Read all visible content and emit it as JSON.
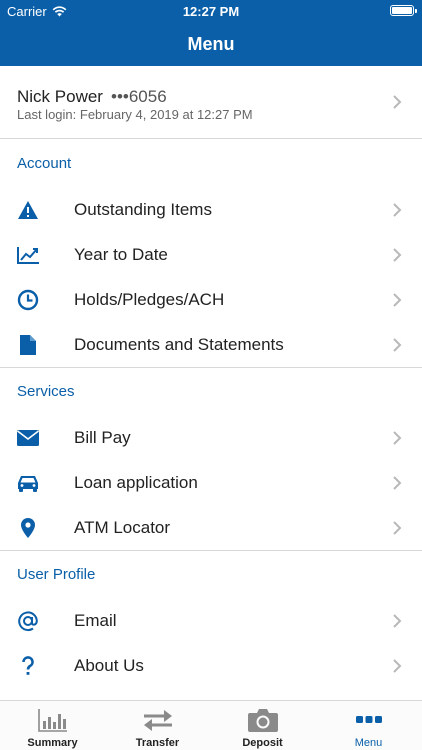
{
  "status": {
    "carrier": "Carrier",
    "time": "12:27 PM"
  },
  "header": {
    "title": "Menu"
  },
  "profile": {
    "name": "Nick Power",
    "account_mask": "•••6056",
    "last_login": "Last login: February 4, 2019 at 12:27 PM"
  },
  "sections": {
    "account": {
      "label": "Account",
      "items": [
        {
          "label": "Outstanding Items",
          "icon": "warning-icon"
        },
        {
          "label": "Year to Date",
          "icon": "trend-chart-icon"
        },
        {
          "label": "Holds/Pledges/ACH",
          "icon": "clock-icon"
        },
        {
          "label": "Documents and Statements",
          "icon": "document-icon"
        }
      ]
    },
    "services": {
      "label": "Services",
      "items": [
        {
          "label": "Bill Pay",
          "icon": "envelope-icon"
        },
        {
          "label": "Loan application",
          "icon": "car-icon"
        },
        {
          "label": "ATM Locator",
          "icon": "location-pin-icon"
        }
      ]
    },
    "user_profile": {
      "label": "User Profile",
      "items": [
        {
          "label": "Email",
          "icon": "at-sign-icon"
        },
        {
          "label": "About Us",
          "icon": "question-icon"
        }
      ]
    }
  },
  "tabbar": {
    "tabs": [
      {
        "label": "Summary",
        "icon": "bar-chart-icon"
      },
      {
        "label": "Transfer",
        "icon": "transfer-arrows-icon"
      },
      {
        "label": "Deposit",
        "icon": "camera-icon"
      },
      {
        "label": "Menu",
        "icon": "more-dots-icon"
      }
    ],
    "active": "Menu"
  },
  "colors": {
    "primary": "#0a5fa8",
    "text": "#222222",
    "muted": "#666666",
    "divider": "#d8d8d8",
    "tab_inactive": "#7a7a7a"
  }
}
